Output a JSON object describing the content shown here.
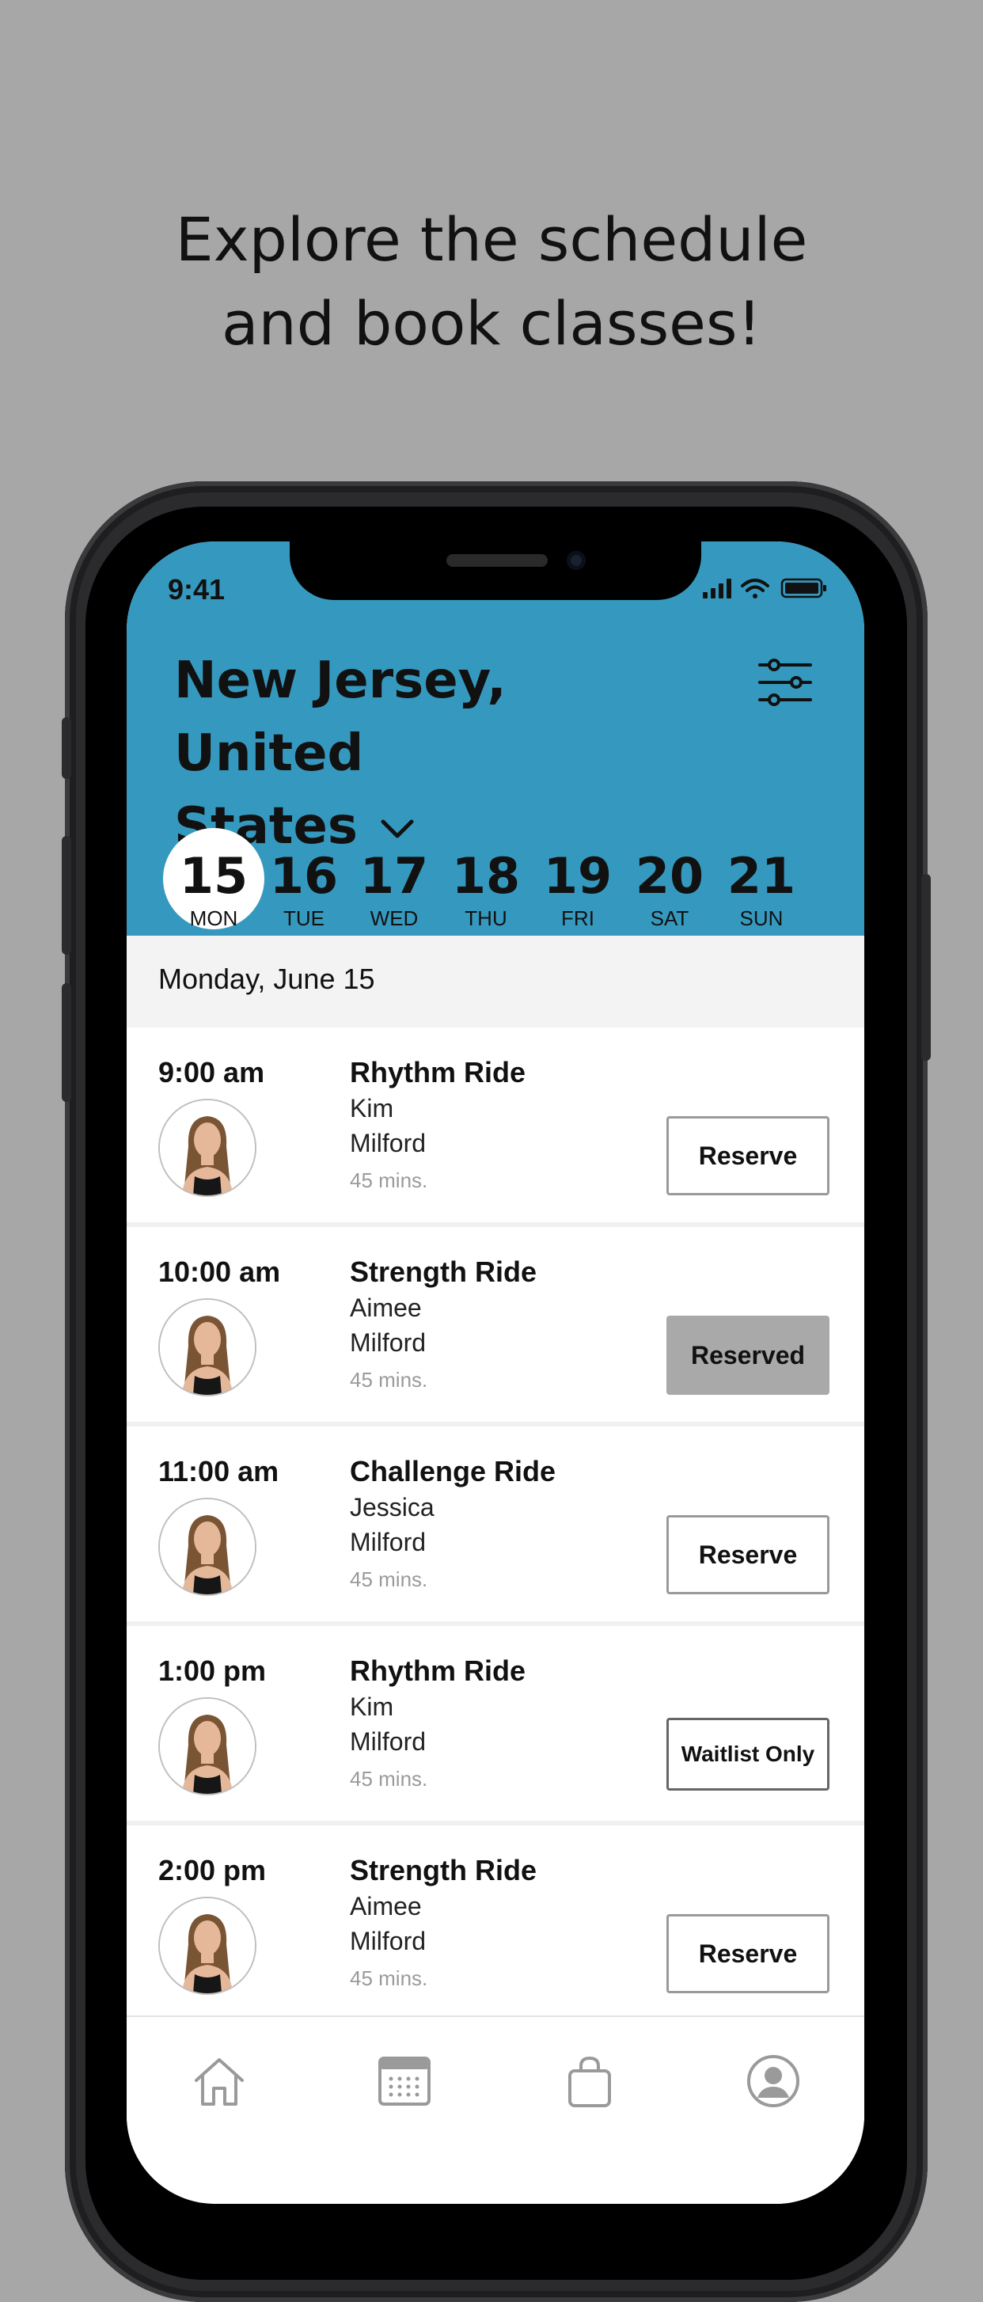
{
  "promo": {
    "line1": "Explore the schedule",
    "line2": "and book classes!"
  },
  "status_bar": {
    "time": "9:41",
    "icons": [
      "signal-icon",
      "wifi-icon",
      "battery-icon"
    ]
  },
  "header": {
    "location_line1": "New Jersey, United",
    "location_line2": "States",
    "background_color": "#3599bf"
  },
  "days": [
    {
      "num": "15",
      "name": "MON",
      "selected": true
    },
    {
      "num": "16",
      "name": "TUE",
      "selected": false
    },
    {
      "num": "17",
      "name": "WED",
      "selected": false
    },
    {
      "num": "18",
      "name": "THU",
      "selected": false
    },
    {
      "num": "19",
      "name": "FRI",
      "selected": false
    },
    {
      "num": "20",
      "name": "SAT",
      "selected": false
    },
    {
      "num": "21",
      "name": "SUN",
      "selected": false
    }
  ],
  "selected_date": "Monday, June 15",
  "classes": [
    {
      "time": "9:00 am",
      "name": "Rhythm Ride",
      "instructor": "Kim",
      "location": "Milford",
      "duration": "45 mins.",
      "action": "Reserve"
    },
    {
      "time": "10:00 am",
      "name": "Strength Ride",
      "instructor": "Aimee",
      "location": "Milford",
      "duration": "45 mins.",
      "action": "Reserved"
    },
    {
      "time": "11:00 am",
      "name": "Challenge Ride",
      "instructor": "Jessica",
      "location": "Milford",
      "duration": "45 mins.",
      "action": "Reserve"
    },
    {
      "time": "1:00 pm",
      "name": "Rhythm Ride",
      "instructor": "Kim",
      "location": "Milford",
      "duration": "45 mins.",
      "action": "Waitlist Only"
    },
    {
      "time": "2:00 pm",
      "name": "Strength Ride",
      "instructor": "Aimee",
      "location": "Milford",
      "duration": "45 mins.",
      "action": "Reserve"
    }
  ],
  "tabbar": {
    "items": [
      "home-icon",
      "calendar-icon",
      "bag-icon",
      "profile-icon"
    ]
  }
}
